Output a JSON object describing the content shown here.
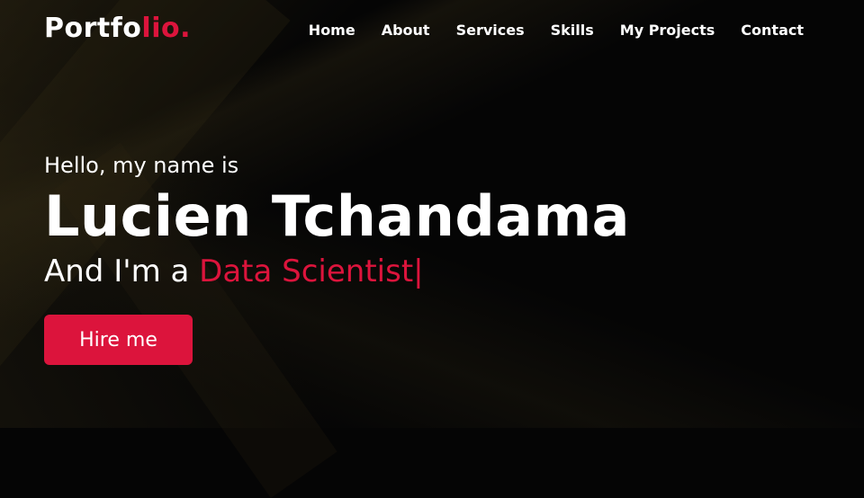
{
  "logo": {
    "text_main": "Portfo",
    "text_accent": "lio."
  },
  "nav": {
    "items": [
      {
        "label": "Home"
      },
      {
        "label": "About"
      },
      {
        "label": "Services"
      },
      {
        "label": "Skills"
      },
      {
        "label": "My Projects"
      },
      {
        "label": "Contact"
      }
    ]
  },
  "hero": {
    "greeting": "Hello, my name is",
    "name": "Lucien Tchandama",
    "role_prefix": "And I'm a ",
    "profession": "Data Scientist",
    "cursor": "|",
    "cta_label": "Hire me"
  },
  "colors": {
    "accent": "#dc143c",
    "background": "#050505",
    "text": "#ffffff"
  }
}
